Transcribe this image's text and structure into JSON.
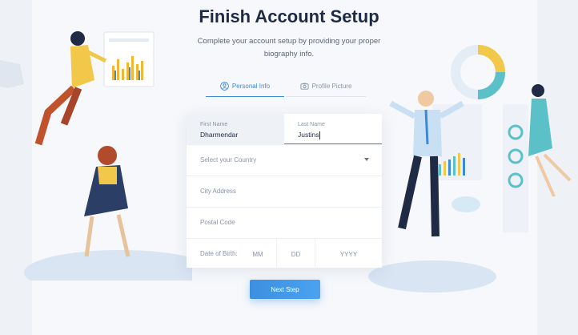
{
  "header": {
    "title": "Finish Account Setup",
    "subtitle": "Complete your account setup by providing your proper biography info."
  },
  "tabs": [
    {
      "label": "Personal Info",
      "icon": "person-icon",
      "active": true
    },
    {
      "label": "Profile Picture",
      "icon": "camera-icon",
      "active": false
    }
  ],
  "form": {
    "first_name": {
      "label": "First Name",
      "value": "Dharmendar"
    },
    "last_name": {
      "label": "Last Name",
      "value": "Justins"
    },
    "country": {
      "placeholder": "Select your Country"
    },
    "city": {
      "placeholder": "City Address"
    },
    "postal": {
      "placeholder": "Postal Code"
    },
    "dob": {
      "label": "Date of Birth:",
      "mm": "MM",
      "dd": "DD",
      "yyyy": "YYYY"
    }
  },
  "actions": {
    "next_label": "Next Step"
  },
  "colors": {
    "accent": "#3b8ad9",
    "title": "#1f2a44",
    "background": "#f6f8fb"
  }
}
